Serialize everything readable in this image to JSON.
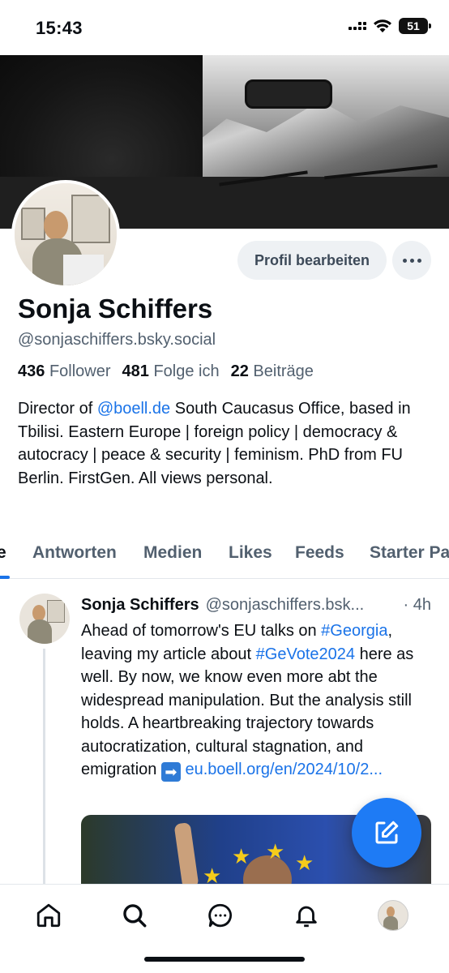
{
  "status_bar": {
    "time": "15:43",
    "battery": "51"
  },
  "profile": {
    "edit_label": "Profil bearbeiten",
    "display_name": "Sonja Schiffers",
    "handle": "@sonjaschiffers.bsky.social",
    "stats": {
      "followers_count": "436",
      "followers_label": "Follower",
      "following_count": "481",
      "following_label": "Folge ich",
      "posts_count": "22",
      "posts_label": "Beiträge"
    },
    "bio": {
      "part1": "Director of ",
      "mention": "@boell.de",
      "part2": " South Caucasus Office, based in Tbilisi. Eastern Europe | foreign policy | democracy & autocracy | peace & security | feminism. PhD from FU Berlin. FirstGen. All views personal."
    }
  },
  "tabs": [
    {
      "label": "e",
      "active": true
    },
    {
      "label": "Antworten"
    },
    {
      "label": "Medien"
    },
    {
      "label": "Likes"
    },
    {
      "label": "Feeds"
    },
    {
      "label": "Starter Pa"
    }
  ],
  "post": {
    "author_name": "Sonja Schiffers",
    "author_handle": "@sonjaschiffers.bsk...",
    "time": "· 4h",
    "text1": "Ahead of tomorrow's EU talks on ",
    "hashtag1": "#Georgia",
    "text2": ", leaving my article about ",
    "hashtag2": "#GeVote2024",
    "text3": " here as well. By now, we know even more abt the widespread manipulation. But the analysis still holds. A heartbreaking trajectory towards autocratization, cultural stagnation, and emigration ",
    "emoji": "➡",
    "link": "eu.boell.org/en/2024/10/2..."
  },
  "bottom_nav": [
    {
      "icon": "home-icon"
    },
    {
      "icon": "search-icon"
    },
    {
      "icon": "chat-icon"
    },
    {
      "icon": "bell-icon"
    },
    {
      "icon": "profile-avatar"
    }
  ],
  "colors": {
    "accent": "#1a73e8",
    "fab": "#1e7bf5",
    "muted_text": "#52606f"
  }
}
